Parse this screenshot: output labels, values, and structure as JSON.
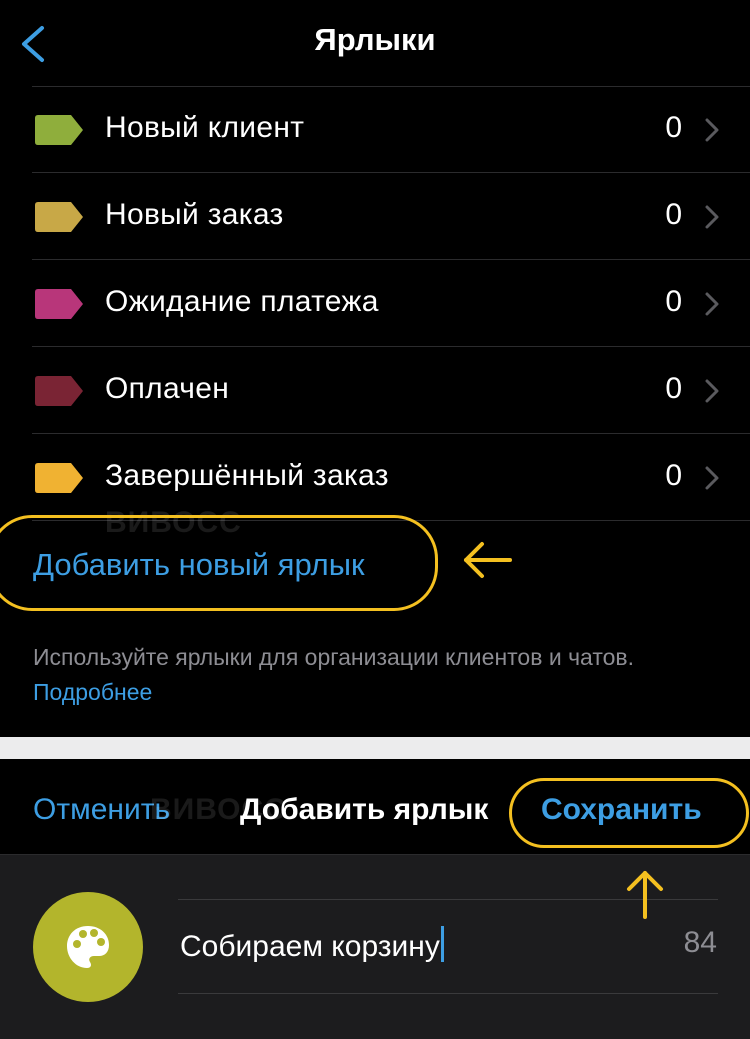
{
  "labels_screen": {
    "title": "Ярлыки",
    "items": [
      {
        "label": "Новый клиент",
        "count": "0",
        "color": "#8fae3c"
      },
      {
        "label": "Новый заказ",
        "count": "0",
        "color": "#c8a847"
      },
      {
        "label": "Ожидание платежа",
        "count": "0",
        "color": "#b8367a"
      },
      {
        "label": "Оплачен",
        "count": "0",
        "color": "#7a2434"
      },
      {
        "label": "Завершённый заказ",
        "count": "0",
        "color": "#f0b232"
      }
    ],
    "add_label": "Добавить новый ярлык",
    "footnote": "Используйте ярлыки для организации клиентов и чатов.",
    "footnote_link": "Подробнее"
  },
  "add_sheet": {
    "cancel": "Отменить",
    "title": "Добавить ярлык",
    "save": "Сохранить",
    "name_value": "Собираем корзину",
    "chars_left": "84",
    "color": "#b3b52c"
  },
  "watermark": "ВИВОСС",
  "colors": {
    "accent": "#3d9ee3",
    "highlight": "#f4c020"
  }
}
